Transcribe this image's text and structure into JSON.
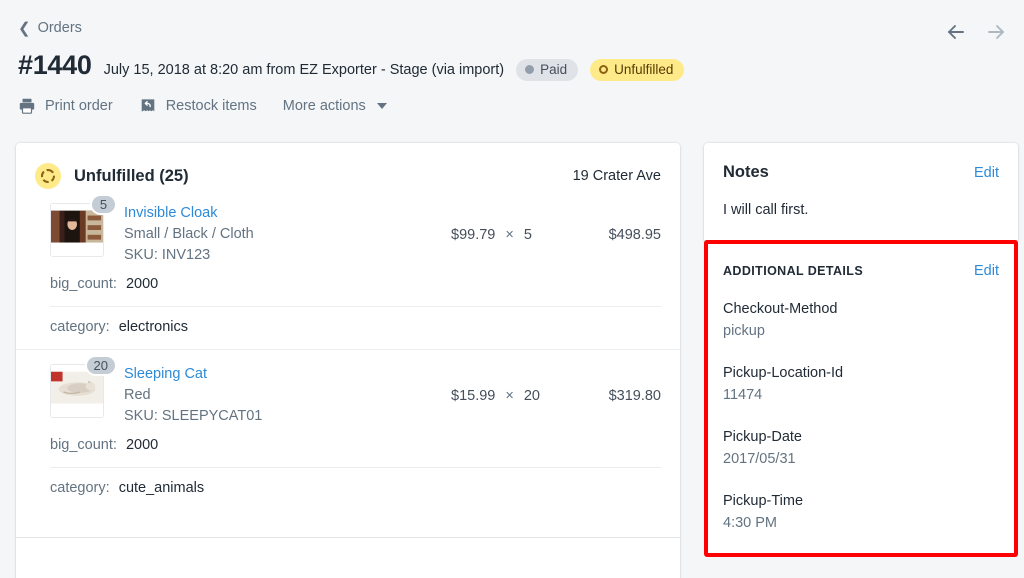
{
  "header": {
    "breadcrumb": "Orders",
    "back_icon": "chevron-left-icon",
    "order_number": "#1440",
    "meta": "July 15, 2018 at 8:20 am from EZ Exporter - Stage (via import)",
    "badges": [
      {
        "label": "Paid",
        "style": "paid",
        "icon": "filled-dot-icon"
      },
      {
        "label": "Unfulfilled",
        "style": "unfulfilled",
        "icon": "ring-dot-icon"
      }
    ],
    "nav": {
      "prev": "previous-order",
      "next": "next-order"
    },
    "actions": [
      {
        "label": "Print order",
        "icon": "printer-icon"
      },
      {
        "label": "Restock items",
        "icon": "restock-icon"
      },
      {
        "label": "More actions",
        "icon": "caret-down-icon"
      }
    ]
  },
  "fulfillment": {
    "status_title": "Unfulfilled (25)",
    "status_icon": "dashed-circle-icon",
    "address": "19 Crater Ave",
    "items": [
      {
        "quantity_badge": "5",
        "name": "Invisible Cloak",
        "variant": "Small / Black / Cloth",
        "sku": "SKU: INV123",
        "price": "$99.79",
        "times": "×",
        "quantity": "5",
        "total": "$498.95",
        "properties": [
          {
            "key": "big_count:",
            "value": "2000"
          },
          {
            "key": "category:",
            "value": "electronics"
          }
        ]
      },
      {
        "quantity_badge": "20",
        "name": "Sleeping Cat",
        "variant": "Red",
        "sku": "SKU: SLEEPYCAT01",
        "price": "$15.99",
        "times": "×",
        "quantity": "20",
        "total": "$319.80",
        "properties": [
          {
            "key": "big_count:",
            "value": "2000"
          },
          {
            "key": "category:",
            "value": "cute_animals"
          }
        ]
      }
    ]
  },
  "sidebar": {
    "notes": {
      "title": "Notes",
      "edit_label": "Edit",
      "body": "I will call first."
    },
    "additional_details": {
      "title": "ADDITIONAL DETAILS",
      "edit_label": "Edit",
      "highlight_color": "#ff0000",
      "fields": [
        {
          "key": "Checkout-Method",
          "value": "pickup"
        },
        {
          "key": "Pickup-Location-Id",
          "value": "11474"
        },
        {
          "key": "Pickup-Date",
          "value": "2017/05/31"
        },
        {
          "key": "Pickup-Time",
          "value": "4:30 PM"
        }
      ]
    }
  },
  "colors": {
    "background": "#f4f6f8",
    "link": "#2e8ad6",
    "subdued": "#637381",
    "paid_badge": "#dfe3e8",
    "unfulfilled_badge": "#ffea8a"
  }
}
